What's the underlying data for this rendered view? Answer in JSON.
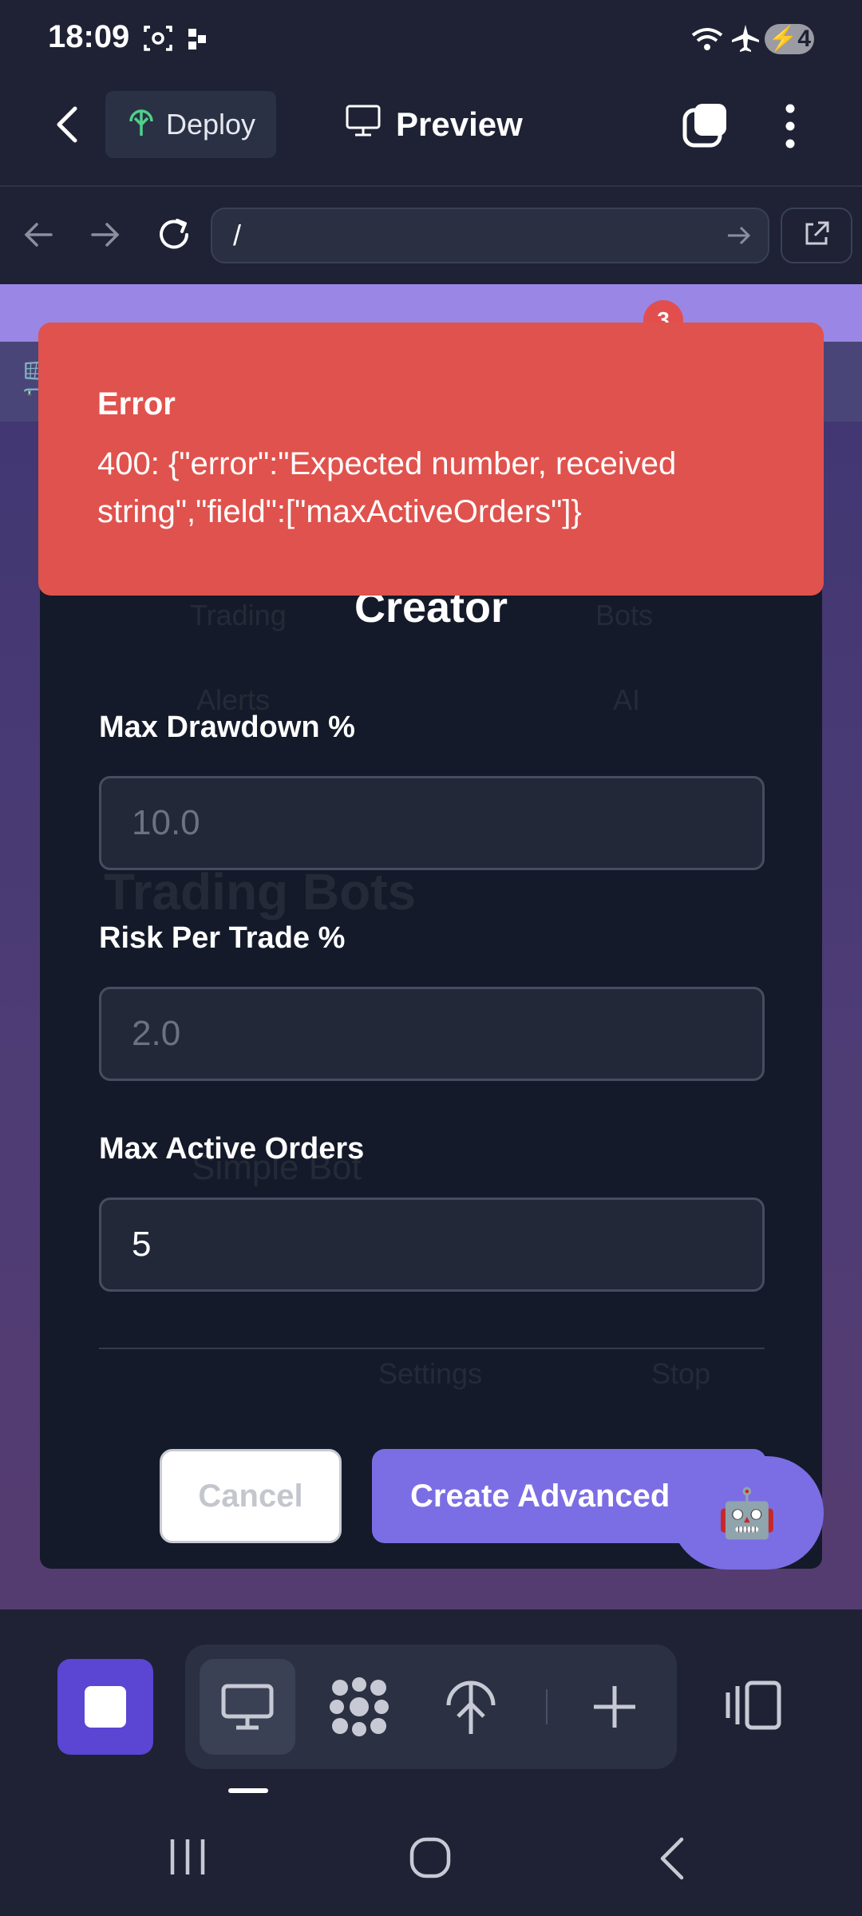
{
  "status_bar": {
    "time": "18:09",
    "battery": "4"
  },
  "app_bar": {
    "deploy_label": "Deploy",
    "preview_label": "Preview"
  },
  "browser": {
    "url": "/"
  },
  "web": {
    "notification_count": "3",
    "background_texts": [
      "Trading",
      "Bots",
      "Alerts",
      "AI",
      "Trading Bots",
      "Simple Bot",
      "Settings",
      "Stop"
    ]
  },
  "modal": {
    "title": "Creator",
    "fields": [
      {
        "label": "Max Drawdown %",
        "placeholder": "10.0",
        "value": ""
      },
      {
        "label": "Risk Per Trade %",
        "placeholder": "2.0",
        "value": ""
      },
      {
        "label": "Max Active Orders",
        "placeholder": "",
        "value": "5"
      }
    ],
    "cancel_label": "Cancel",
    "create_label": "Create Advanced Bot"
  },
  "toast": {
    "title": "Error",
    "message": "400: {\"error\":\"Expected number, received string\",\"field\":[\"maxActiveOrders\"]}"
  },
  "fab": {
    "icon": "robot-icon"
  },
  "colors": {
    "accent": "#7b6ee4",
    "error": "#e0524d",
    "background": "#1e2234",
    "modal": "#141a29"
  }
}
